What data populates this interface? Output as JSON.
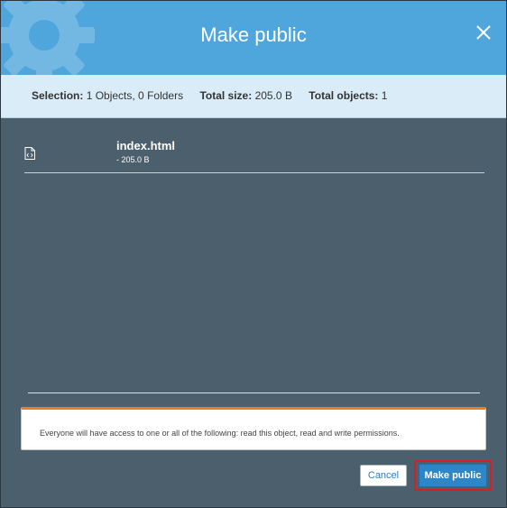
{
  "dialog": {
    "title": "Make public",
    "close_icon": "close-icon"
  },
  "summary": {
    "selection_label": "Selection:",
    "selection_value": "1 Objects, 0 Folders",
    "total_size_label": "Total size:",
    "total_size_value": "205.0 B",
    "total_objects_label": "Total objects:",
    "total_objects_value": "1"
  },
  "files": [
    {
      "icon": "html-file-icon",
      "name": "index.html",
      "size": "- 205.0 B"
    }
  ],
  "warning": {
    "text": "Everyone will have access to one or all of the following: read this object, read and write permissions."
  },
  "buttons": {
    "cancel_label": "Cancel",
    "make_public_label": "Make public"
  },
  "colors": {
    "header_bg": "#4ea6dc",
    "summary_bg": "#d9ecf8",
    "body_bg": "#4b5f6d",
    "warning_accent": "#ef7b1e",
    "primary_button": "#2c86c8",
    "highlight_outline": "#d2202a"
  }
}
